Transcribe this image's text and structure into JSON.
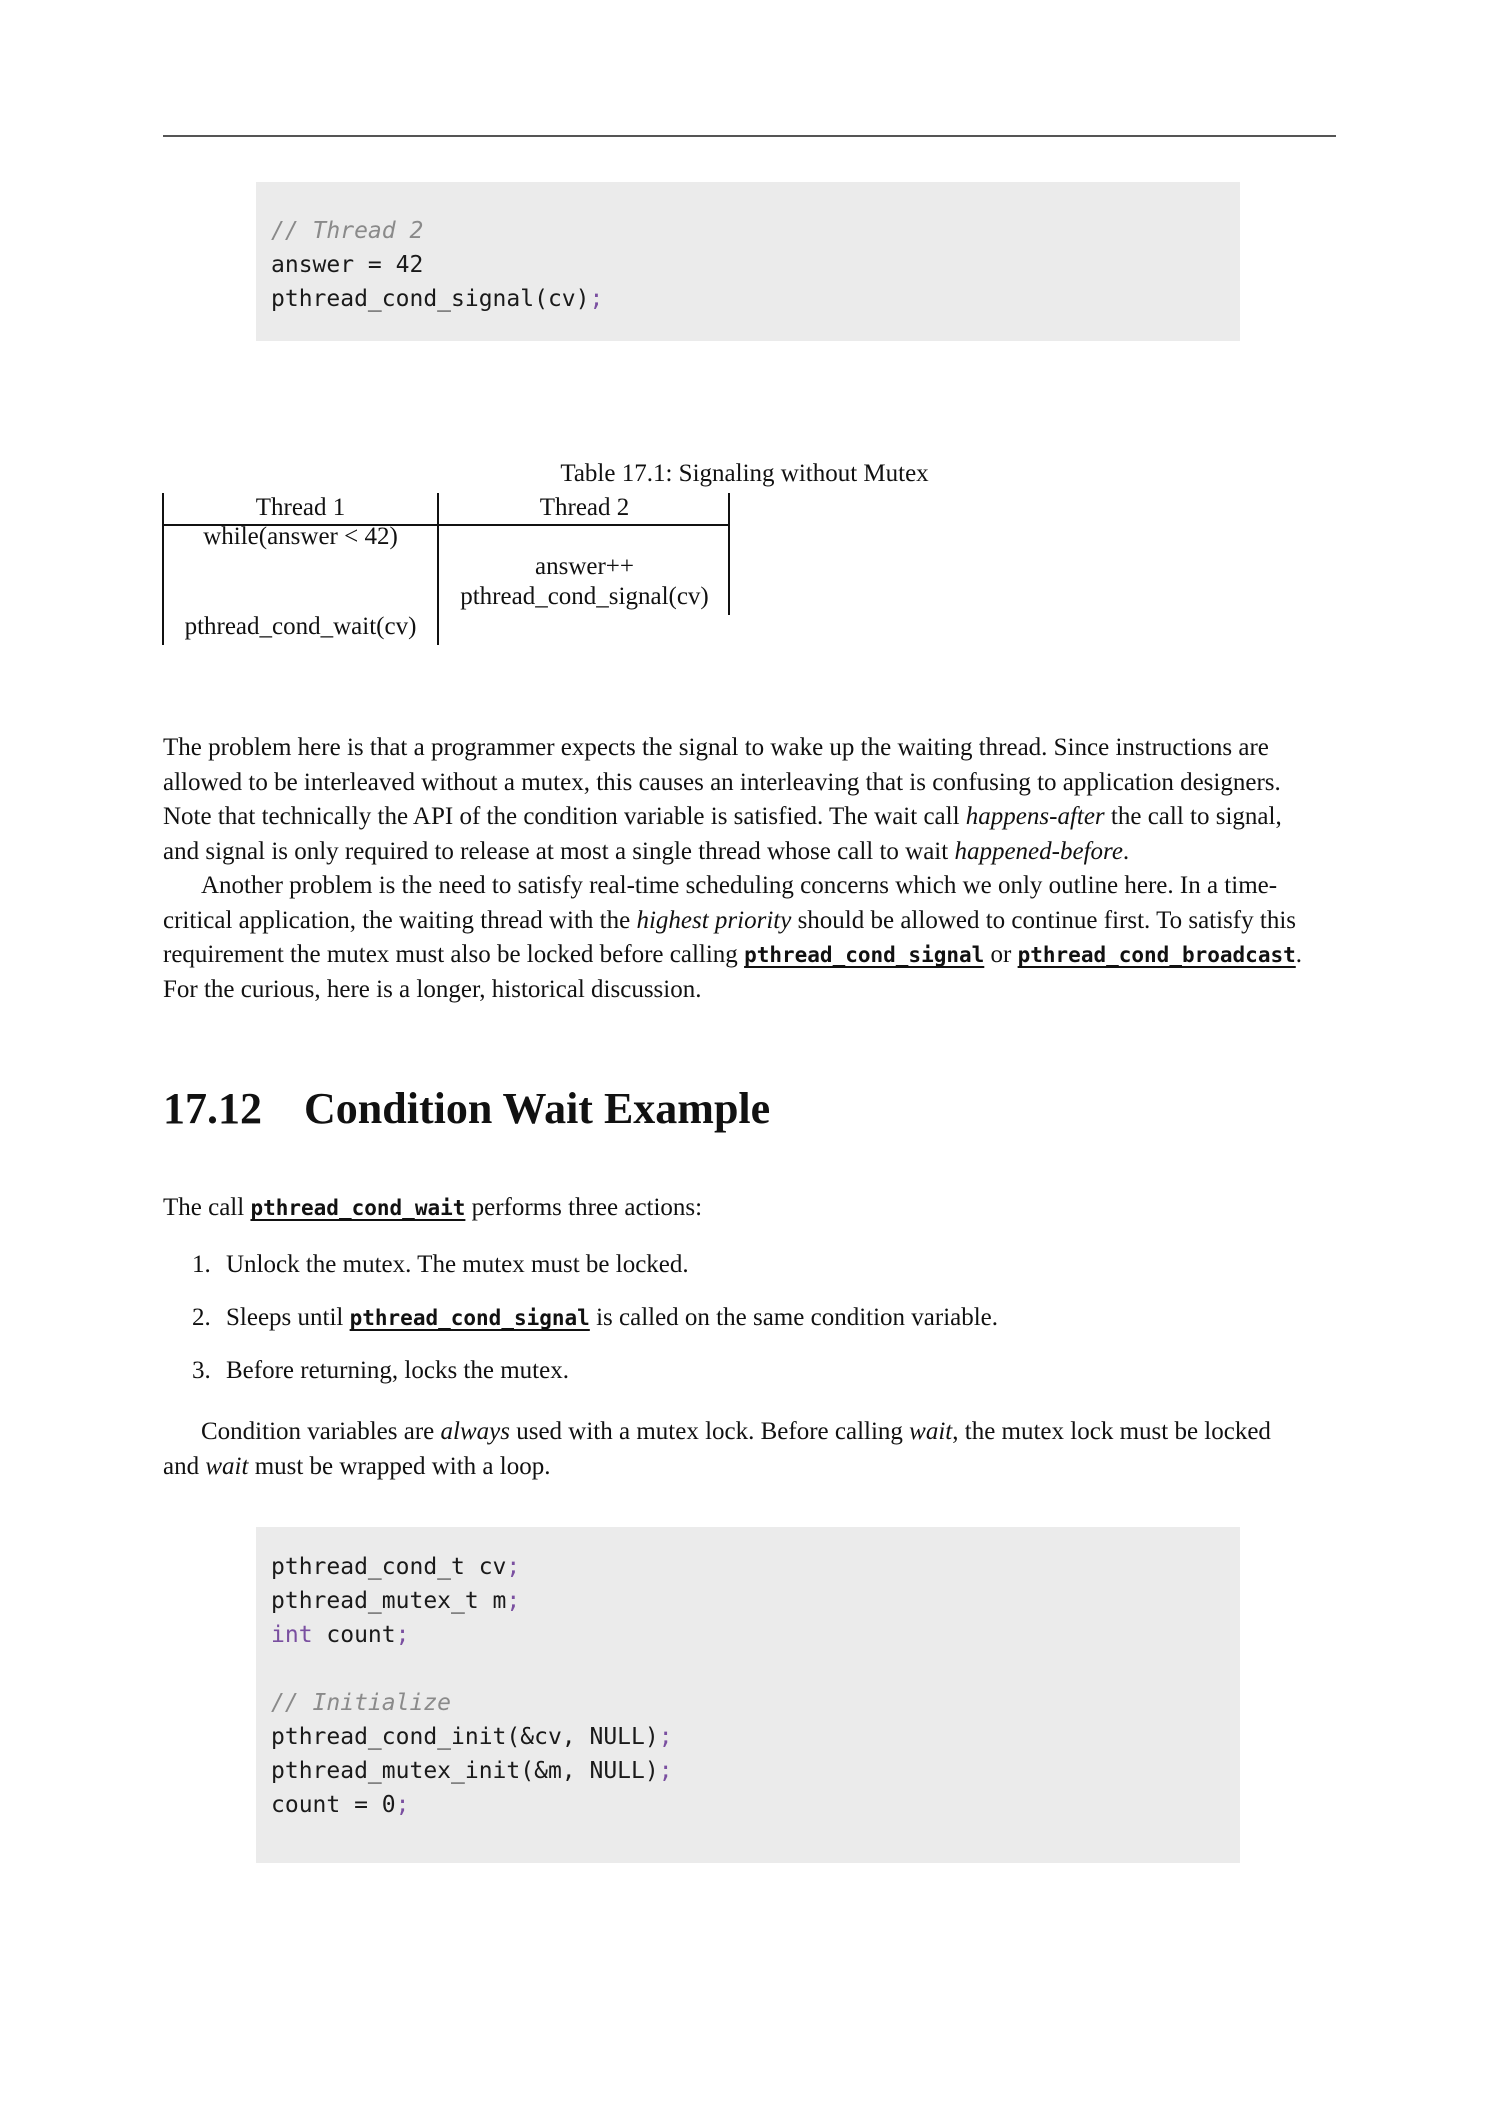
{
  "code_block_1": {
    "comment": "// Thread 2",
    "line2": "answer = 42",
    "line3_call": "pthread_cond_signal(cv)",
    "line3_semi": ";"
  },
  "table": {
    "caption": "Table 17.1: Signaling without Mutex",
    "headers": [
      "Thread 1",
      "Thread 2"
    ],
    "cells": {
      "t1_row1": "while(answer < 42)",
      "t2_row2": "answer++",
      "t2_row3": "pthread_cond_signal(cv)",
      "t1_row4": "pthread_cond_wait(cv)"
    }
  },
  "paragraph_1": {
    "l1": "The problem here is that a programmer expects the signal to wake up the waiting thread. Since instructions are",
    "l2": "allowed to be interleaved without a mutex, this causes an interleaving that is confusing to application designers.",
    "l3a": "Note that technically the API of the condition variable is satisfied. The wait call ",
    "l3b": "happens-after",
    "l3c": " the call to signal,",
    "l4a": "and signal is only required to release at most a single thread whose call to wait ",
    "l4b": "happened-before",
    "l4c": "."
  },
  "paragraph_2": {
    "l1": "Another problem is the need to satisfy real-time scheduling concerns which we only outline here. In a time-",
    "l2a": "critical application, the waiting thread with the ",
    "l2b": "highest priority",
    "l2c": " should be allowed to continue first. To satisfy this",
    "l3a": "requirement the mutex must also be locked before calling ",
    "l3b": "pthread_cond_signal",
    "l3c": " or ",
    "l3d": "pthread_cond_broadcast",
    "l3e": ".",
    "l4": "For the curious, here is a longer, historical discussion."
  },
  "section": {
    "number": "17.12",
    "title": "Condition Wait Example"
  },
  "intro": {
    "a": "The call ",
    "b": "pthread_cond_wait",
    "c": " performs three actions:"
  },
  "list": {
    "item1_num": "1.",
    "item1": "Unlock the mutex. The mutex must be locked.",
    "item2_num": "2.",
    "item2a": "Sleeps until ",
    "item2b": "pthread_cond_signal",
    "item2c": " is called on the same condition variable.",
    "item3_num": "3.",
    "item3": "Before returning, locks the mutex."
  },
  "paragraph_3": {
    "l1a": "Condition variables are ",
    "l1b": "always",
    "l1c": " used with a mutex lock. Before calling ",
    "l1d": "wait",
    "l1e": ", the mutex lock must be locked",
    "l2a": "and ",
    "l2b": "wait",
    "l2c": " must be wrapped with a loop."
  },
  "code_block_2": {
    "l1": "pthread_cond_t cv",
    "l2": "pthread_mutex_t m",
    "l3_kw": "int",
    "l3": " count",
    "comment": "// Initialize",
    "l5": "pthread_cond_init(&cv, NULL)",
    "l6": "pthread_mutex_init(&m, NULL)",
    "l7": "count = 0",
    "semi": ";"
  }
}
